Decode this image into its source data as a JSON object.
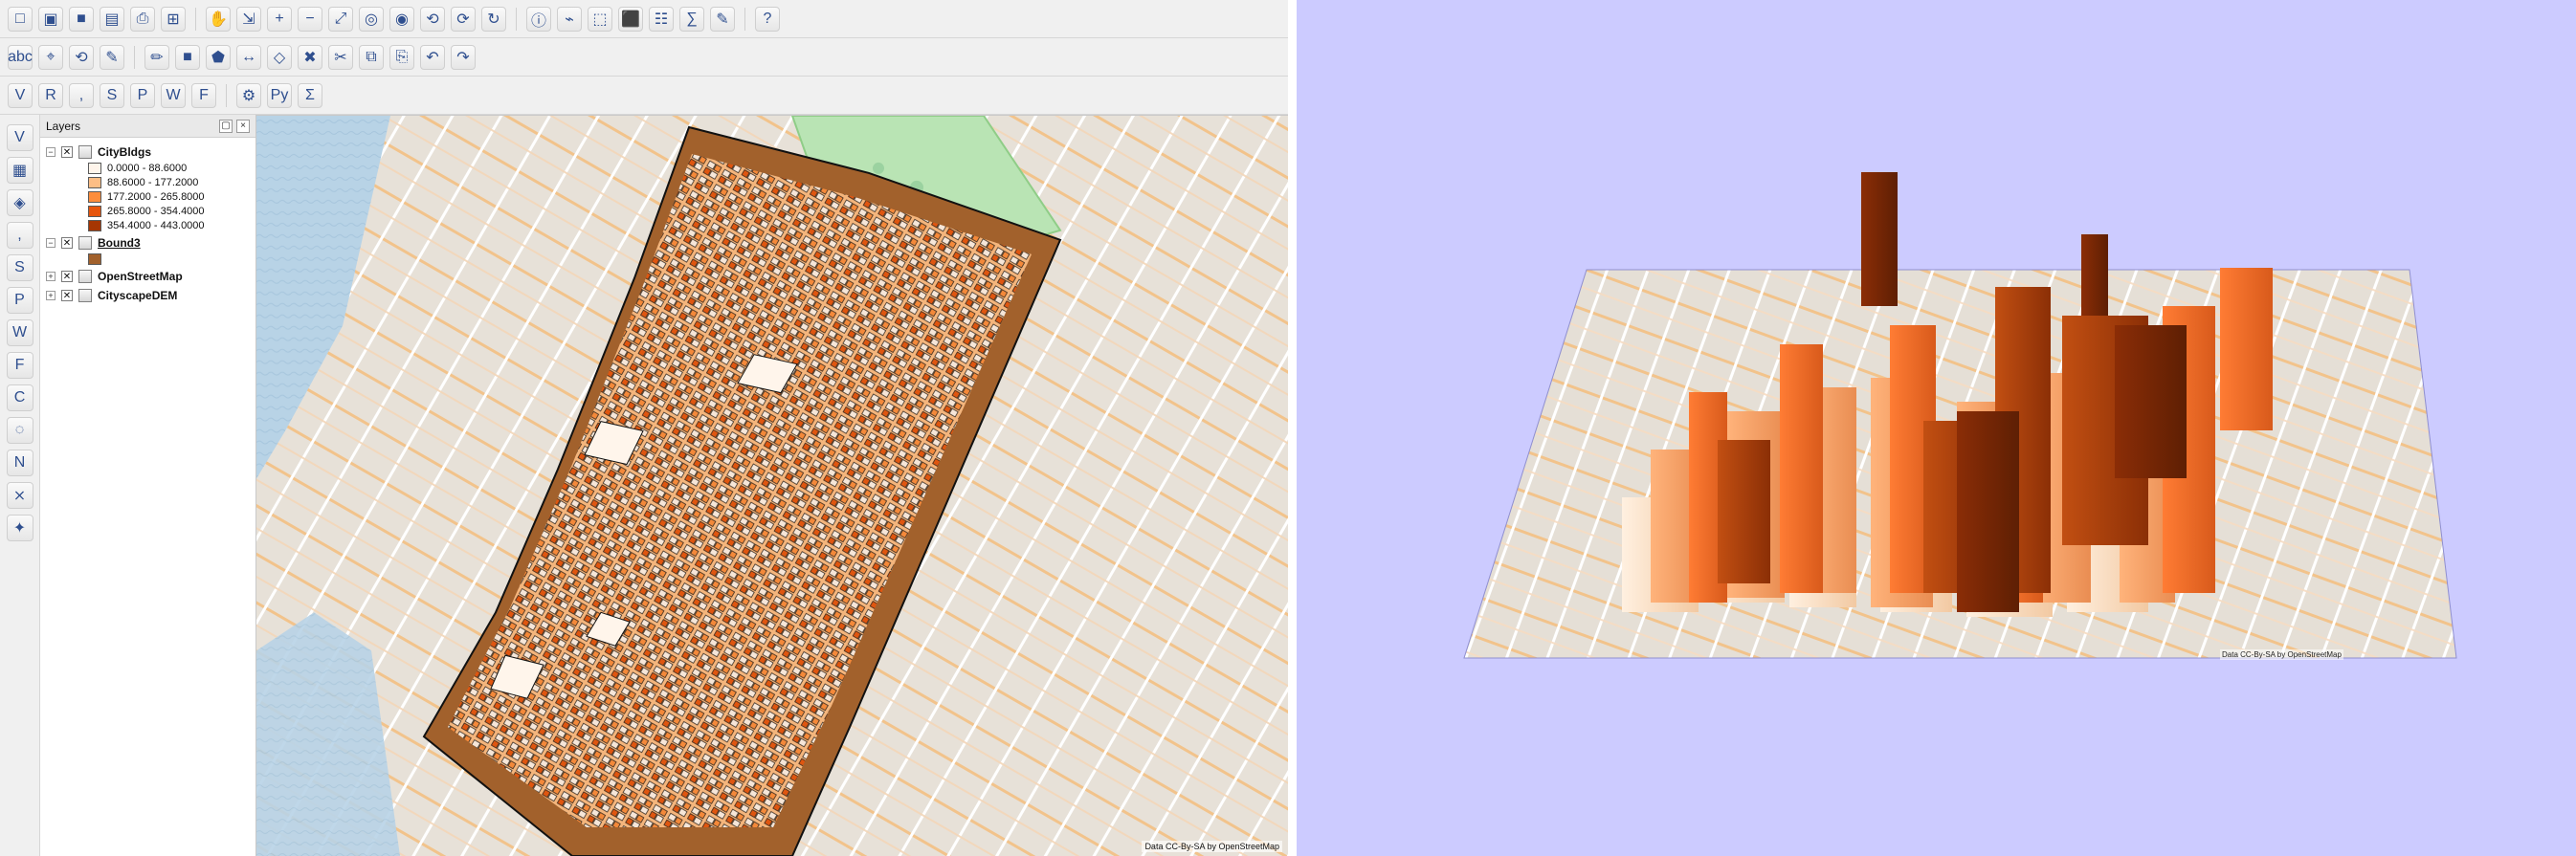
{
  "qgis": {
    "layers_panel_title": "Layers",
    "layers": [
      {
        "name": "CityBldgs",
        "checked": true,
        "legend": [
          {
            "label": "0.0000 - 88.6000",
            "color": "#fff5eb"
          },
          {
            "label": "88.6000 - 177.2000",
            "color": "#fdbe85"
          },
          {
            "label": "177.2000 - 265.8000",
            "color": "#fd8d3c"
          },
          {
            "label": "265.8000 - 354.4000",
            "color": "#e6550d"
          },
          {
            "label": "354.4000 - 443.0000",
            "color": "#a63603"
          }
        ]
      },
      {
        "name": "Bound3",
        "checked": true,
        "swatch_color": "#a2612c"
      },
      {
        "name": "OpenStreetMap",
        "checked": true
      },
      {
        "name": "CityscapeDEM",
        "checked": true
      }
    ],
    "map": {
      "attribution_text": "Data CC-By-SA by OpenStreetMap"
    }
  },
  "view3d": {
    "background_color": "#cccbff",
    "attribution_text": "Data CC-By-SA by OpenStreetMap"
  },
  "icons": {
    "toolbar_top_1": [
      "new-project-icon",
      "open-project-icon",
      "save-project-icon",
      "save-as-icon",
      "print-layout-icon",
      "layout-manager-icon",
      "pan-icon",
      "pan-to-selection-icon",
      "zoom-in-icon",
      "zoom-out-icon",
      "zoom-full-icon",
      "zoom-to-selection-icon",
      "zoom-to-layer-icon",
      "zoom-last-icon",
      "zoom-next-icon",
      "refresh-icon",
      "identify-icon",
      "measure-icon",
      "select-icon",
      "deselect-icon",
      "attribute-table-icon",
      "statistics-icon",
      "annotation-icon",
      "help-icon"
    ],
    "toolbar_top_2": [
      "label-icon",
      "pin-label-icon",
      "rotate-label-icon",
      "change-label-icon",
      "toggle-editing-icon",
      "save-edits-icon",
      "digitize-icon",
      "move-feature-icon",
      "node-tool-icon",
      "delete-selected-icon",
      "cut-icon",
      "copy-icon",
      "paste-icon",
      "undo-icon",
      "redo-icon"
    ],
    "toolbar_top_3": [
      "add-vector-layer-icon",
      "add-raster-layer-icon",
      "add-csv-icon",
      "add-spatialite-icon",
      "add-postgis-icon",
      "add-wms-icon",
      "add-wfs-icon",
      "processing-icon",
      "python-console-icon",
      "field-calculator-icon"
    ],
    "left_tools": [
      "add-vector-icon",
      "add-raster-icon",
      "add-mesh-icon",
      "add-delimited-text-icon",
      "add-spatialite-icon",
      "add-postgis-icon",
      "add-wms-icon",
      "add-wfs-icon",
      "add-wcs-icon",
      "add-virtual-layer-icon",
      "new-shapefile-icon",
      "remove-layer-icon",
      "style-manager-icon"
    ]
  }
}
